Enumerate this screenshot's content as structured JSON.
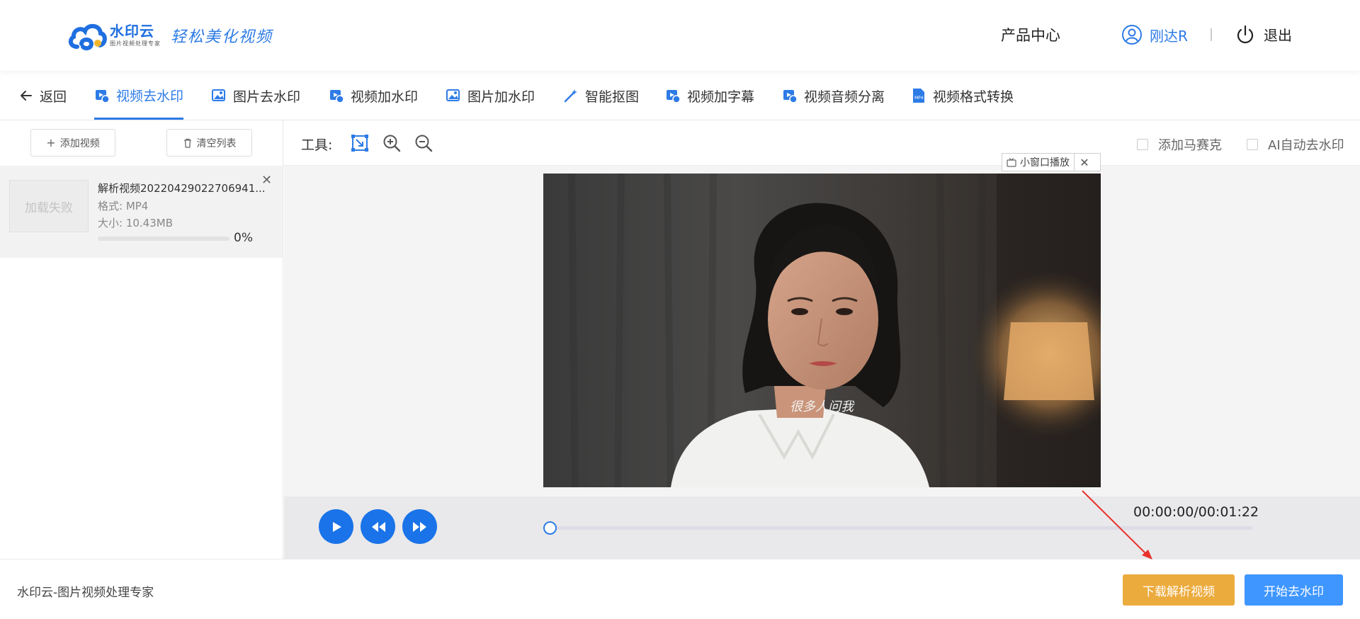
{
  "header": {
    "logo_name": "水印云",
    "logo_sub": "图片视频处理专家",
    "slogan": "轻松美化视频",
    "product_center": "产品中心",
    "username": "刚达R",
    "logout": "退出"
  },
  "nav": {
    "back": "返回",
    "tabs": [
      {
        "label": "视频去水印",
        "active": true
      },
      {
        "label": "图片去水印"
      },
      {
        "label": "视频加水印"
      },
      {
        "label": "图片加水印"
      },
      {
        "label": "智能抠图"
      },
      {
        "label": "视频加字幕"
      },
      {
        "label": "视频音频分离"
      },
      {
        "label": "视频格式转换"
      }
    ]
  },
  "left_panel": {
    "add_video": "添加视频",
    "clear_list": "清空列表",
    "files": [
      {
        "thumb_text": "加载失败",
        "name": "解析视频20220429022706941...",
        "format": "格式:  MP4",
        "size": "大小:  10.43MB",
        "progress": 0,
        "progress_label": "0%"
      }
    ]
  },
  "toolbar": {
    "label": "工具:",
    "mosaic": "添加马赛克",
    "ai_remove": "AI自动去水印",
    "mini_play": "小窗口播放"
  },
  "player": {
    "caption": "很多人问我",
    "time": "00:00:00/00:01:22",
    "progress": 0
  },
  "footer": {
    "brand": "水印云-图片视频处理专家",
    "download": "下载解析视频",
    "start": "开始去水印"
  },
  "colors": {
    "accent": "#2d7be6",
    "primary_button": "#3f96ff",
    "download_button": "#ecab3d",
    "control_blue": "#1a73e8",
    "annotation_arrow": "#e8322b"
  }
}
